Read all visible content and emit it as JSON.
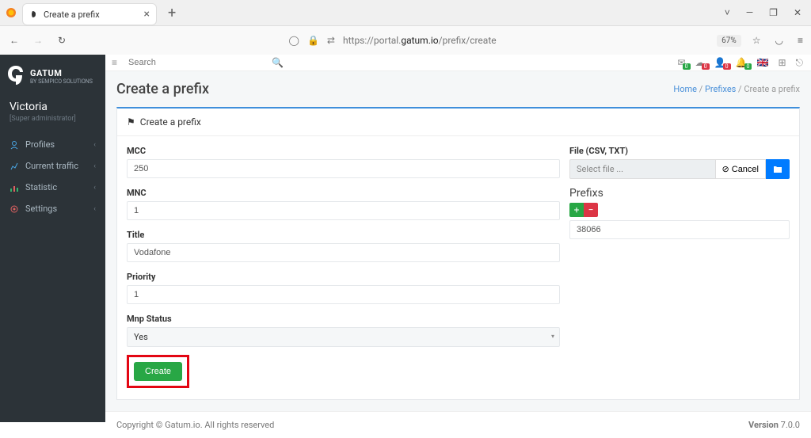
{
  "browser": {
    "tab_title": "Create a prefix",
    "url_prefix": "https://portal.",
    "url_domain": "gatum.io",
    "url_path": "/prefix/create",
    "zoom": "67%"
  },
  "sidebar": {
    "brand_name": "GATUM",
    "brand_sub": "BY SEMPICO SOLUTIONS",
    "username": "Victoria",
    "userrole": "[Super administrator]",
    "items": [
      {
        "label": "Profiles",
        "icon_color": "#4aa7e6"
      },
      {
        "label": "Current traffic",
        "icon_color": "#4aa7e6"
      },
      {
        "label": "Statistic",
        "icon_color": "#33b26b"
      },
      {
        "label": "Settings",
        "icon_color": "#e06262"
      }
    ]
  },
  "topbar": {
    "search_placeholder": "Search",
    "menu_icon": "≡",
    "badges": [
      "0",
      "0",
      "0",
      "0"
    ]
  },
  "page": {
    "title": "Create a prefix",
    "breadcrumb": {
      "home": "Home",
      "mid": "Prefixes",
      "current": "Create a prefix"
    },
    "box_title": "Create a prefix"
  },
  "form": {
    "mcc": {
      "label": "MCC",
      "value": "250"
    },
    "mnc": {
      "label": "MNC",
      "value": "1"
    },
    "title": {
      "label": "Title",
      "value": "Vodafone"
    },
    "priority": {
      "label": "Priority",
      "value": "1"
    },
    "mnp": {
      "label": "Mnp Status",
      "value": "Yes"
    },
    "submit": "Create"
  },
  "fileblock": {
    "label": "File (CSV, TXT)",
    "placeholder": "Select file ...",
    "cancel": "Cancel"
  },
  "prefixs": {
    "title": "Prefixs",
    "items": [
      "38066"
    ]
  },
  "footer": {
    "copyright": "Copyright © Gatum.io. All rights reserved",
    "version_label": "Version ",
    "version": "7.0.0"
  }
}
